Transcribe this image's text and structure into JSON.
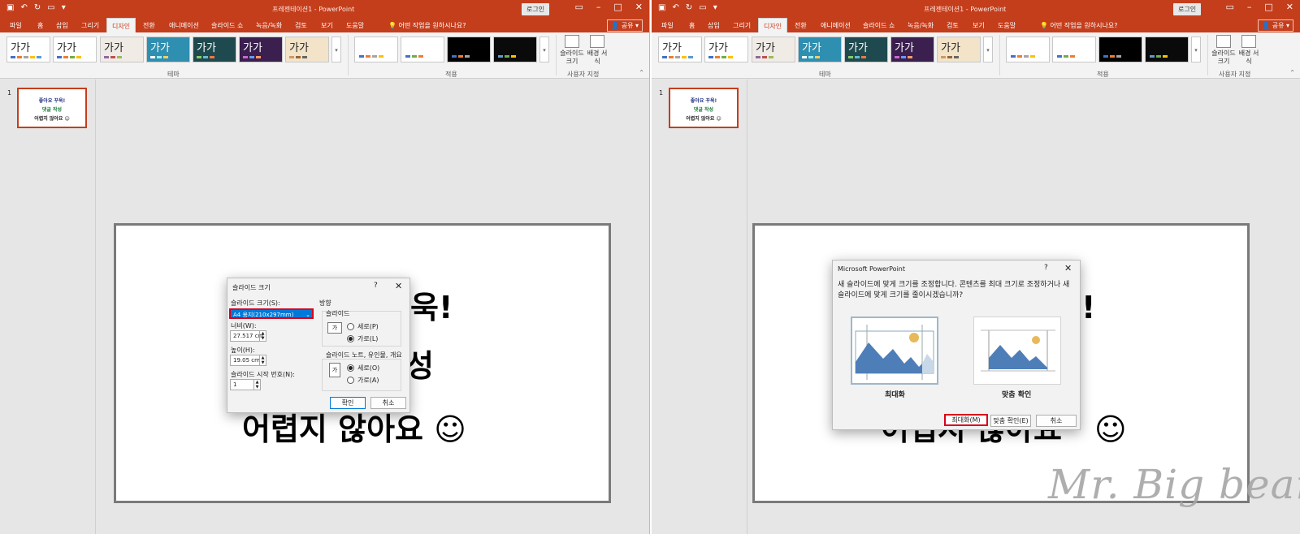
{
  "left": {
    "window_title": "프레젠테이션1 - PowerPoint",
    "login": "로그인",
    "share": "공유",
    "tabs": [
      "파일",
      "홈",
      "삽입",
      "그리기",
      "디자인",
      "전환",
      "애니메이션",
      "슬라이드 쇼",
      "녹음/녹화",
      "검토",
      "보기",
      "도움말"
    ],
    "tell_me": "어떤 작업을 원하시나요?",
    "theme_label": "가가",
    "group_theme": "테마",
    "group_variant": "적용",
    "group_custom": "사용자 지정",
    "btn_slide_size": "슬라이드 크기",
    "btn_bg_format": "배경 서식",
    "slide_number": "1",
    "thumb_lines": [
      "좋아요 꾸욱!",
      "댓글 작성",
      "어렵지 않아요 ☺"
    ],
    "slide_line1_tail": "욱!",
    "slide_line2_tail": "성",
    "slide_line3": "어렵지 않아요 ☺",
    "dialog": {
      "title": "슬라이드 크기",
      "help": "?",
      "size_label": "슬라이드 크기(S):",
      "size_value": "A4 용지(210x297mm)",
      "width_label": "너비(W):",
      "width_value": "27.517 cm",
      "height_label": "높이(H):",
      "height_value": "19.05 cm",
      "start_label": "슬라이드 시작 번호(N):",
      "start_value": "1",
      "orientation_label": "방향",
      "slides_label": "슬라이드",
      "portrait": "세로(P)",
      "landscape": "가로(L)",
      "notes_label": "슬라이드 노트, 유인물, 개요",
      "notes_portrait": "세로(O)",
      "notes_landscape": "가로(A)",
      "ok": "확인",
      "cancel": "취소"
    }
  },
  "right": {
    "window_title": "프레젠테이션1 - PowerPoint",
    "login": "로그인",
    "share": "공유",
    "tell_me": "어떤 작업을 원하시나요?",
    "slide_number": "1",
    "thumb_lines": [
      "좋아요 꾸욱!",
      "댓글 작성",
      "어렵지 않아요 ☺"
    ],
    "dialog": {
      "title": "Microsoft PowerPoint",
      "help": "?",
      "message": "새 슬라이드에 맞게 크기를 조정합니다. 콘텐츠를 최대 크기로 조정하거나 새 슬라이드에 맞게 크기를 줄이시겠습니까?",
      "option_maximize": "최대화",
      "option_ensure_fit": "맞춤 확인",
      "btn_maximize": "최대화(M)",
      "btn_ensure_fit": "맞춤 확인(E)",
      "btn_cancel": "취소"
    },
    "slide_tail1": "!",
    "slide_line3_partial": "어렵지 않아요",
    "smiley": "☺"
  },
  "watermark": "Mr. Big bear.",
  "colors": {
    "accent": "#c43e1c",
    "highlight_box": "#d9001b",
    "selection": "#0078d7"
  }
}
